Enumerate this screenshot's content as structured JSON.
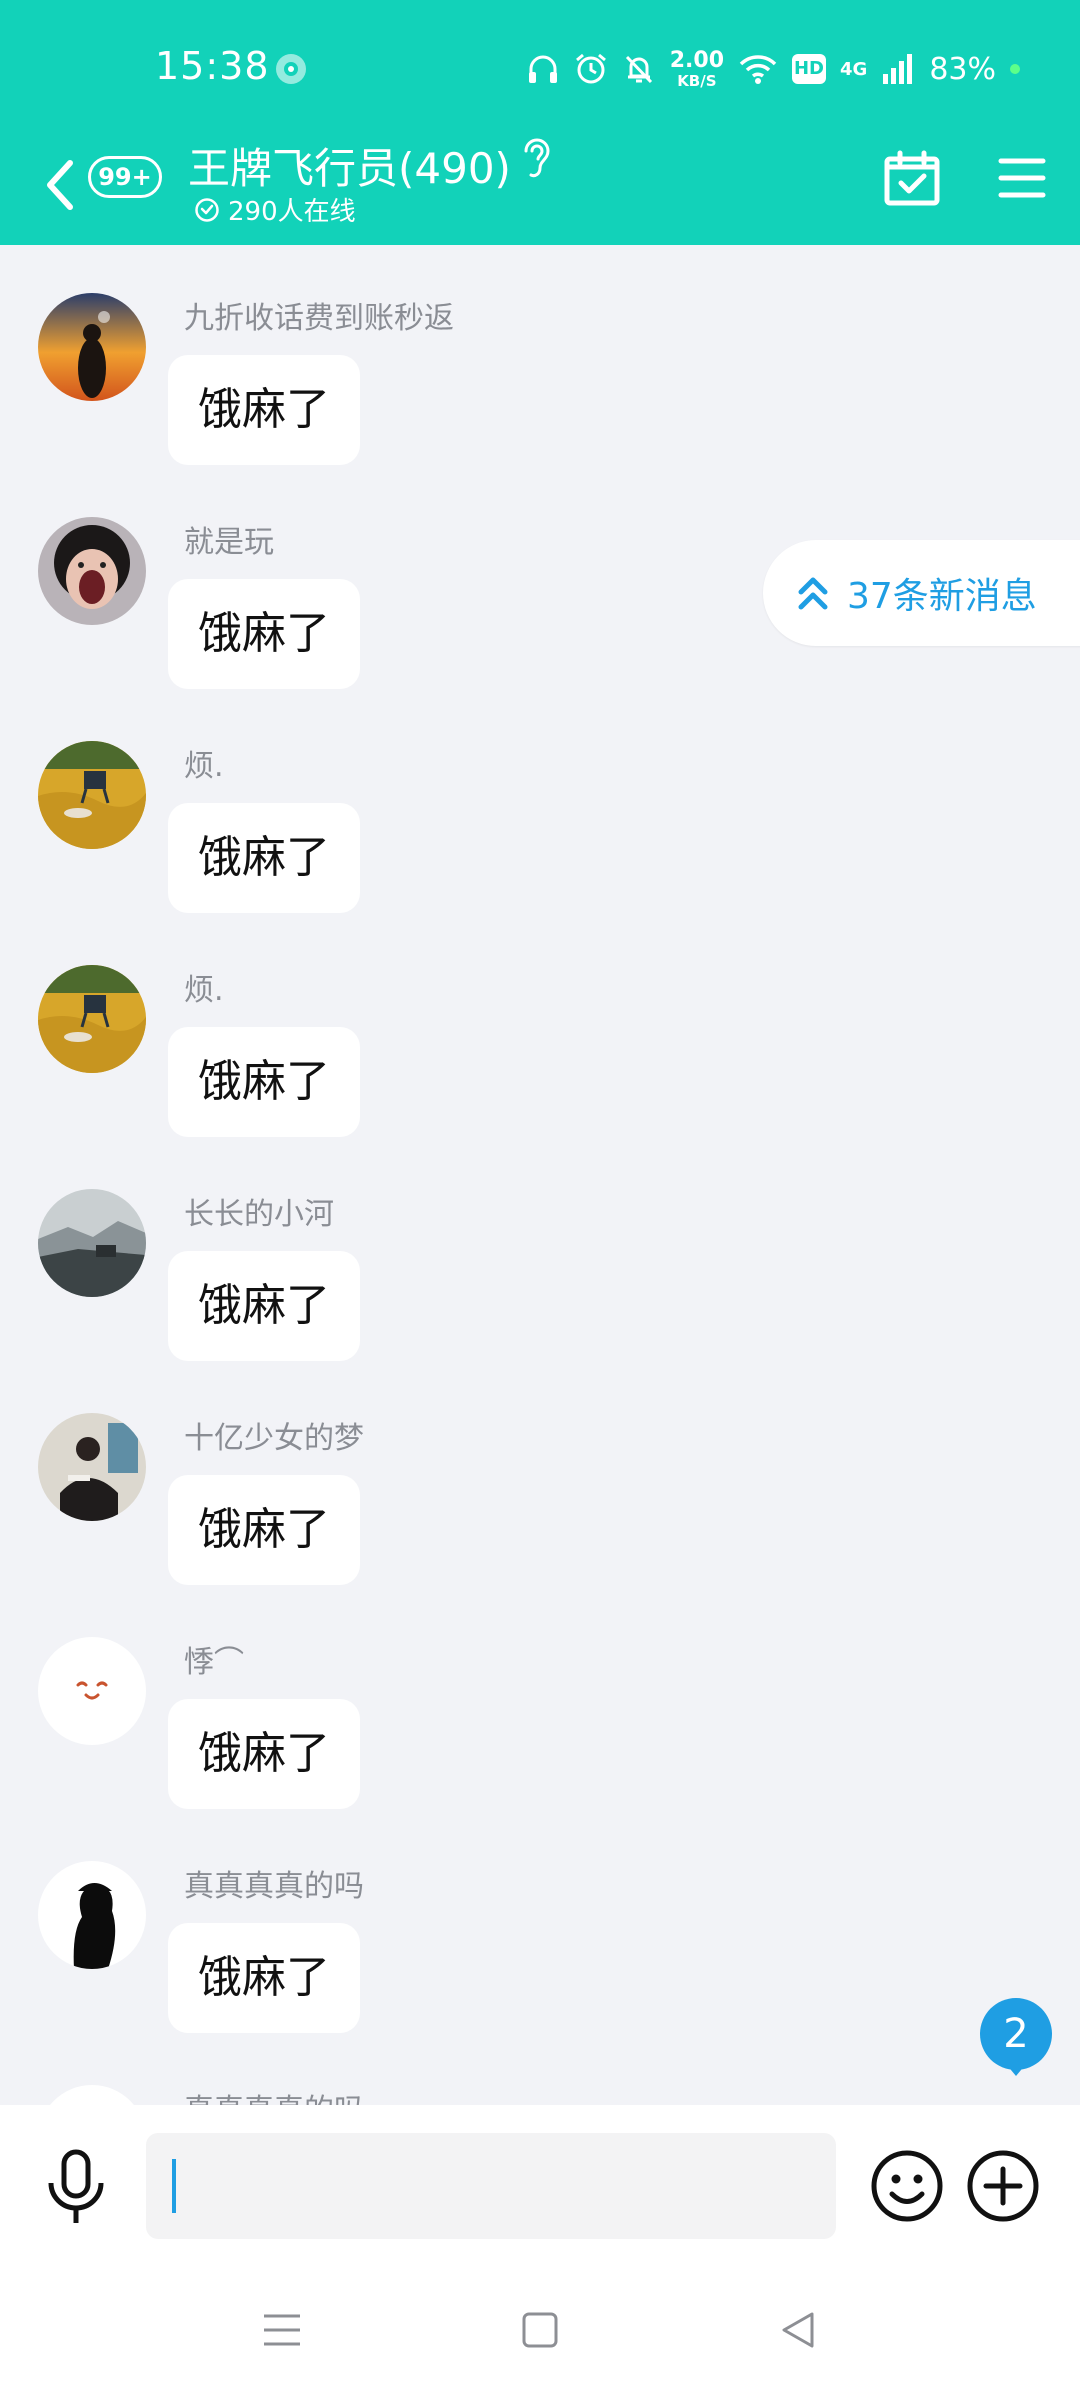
{
  "status_bar": {
    "time": "15:38",
    "net_speed_value": "2.00",
    "net_speed_unit": "KB/S",
    "hd_label": "HD",
    "network_type": "4G",
    "battery": "83%"
  },
  "header": {
    "unread_count": "99+",
    "title": "王牌飞行员(490)",
    "online": "290人在线"
  },
  "new_messages_label": "37条新消息",
  "messages": [
    {
      "sender": "九折收话费到账秒返",
      "text": "饿麻了",
      "avatar": "sunset-avatar"
    },
    {
      "sender": "就是玩",
      "text": "饿麻了",
      "avatar": "screaming-face-avatar"
    },
    {
      "sender": "烦.",
      "text": "饿麻了",
      "avatar": "wheat-field-avatar"
    },
    {
      "sender": "烦.",
      "text": "饿麻了",
      "avatar": "wheat-field-avatar"
    },
    {
      "sender": "长长的小河",
      "text": "饿麻了",
      "avatar": "mountain-avatar"
    },
    {
      "sender": "十亿少女的梦",
      "text": "饿麻了",
      "avatar": "photo-man-avatar"
    },
    {
      "sender": "悸⌒",
      "text": "饿麻了",
      "avatar": "cute-face-avatar"
    },
    {
      "sender": "真真真真的吗",
      "text": "饿麻了",
      "avatar": "silhouette-avatar"
    },
    {
      "sender": "真真真真的吗",
      "text": "",
      "avatar": "silhouette-avatar"
    }
  ],
  "mention_count": "2",
  "input": {
    "value": "",
    "placeholder": ""
  },
  "colors": {
    "brand_teal": "#12d2b9",
    "accent_blue": "#1f9ee3",
    "background": "#f2f3f7"
  }
}
